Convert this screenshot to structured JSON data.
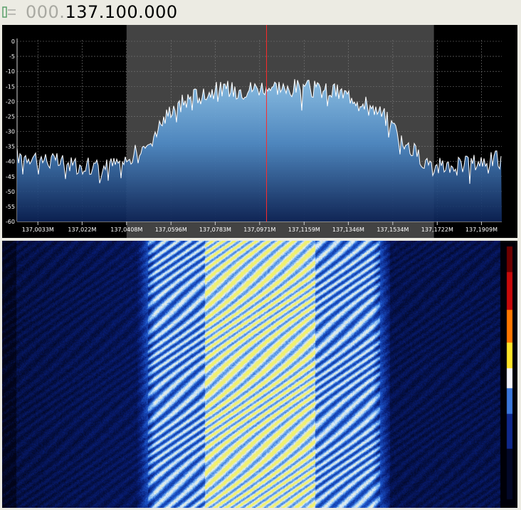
{
  "frequency": {
    "prefix": "000.",
    "value": "137.100.000"
  },
  "spectrum": {
    "y_ticks": [
      "0",
      "-5",
      "-10",
      "-15",
      "-20",
      "-25",
      "-30",
      "-35",
      "-40",
      "-45",
      "-50",
      "-55",
      "-60"
    ],
    "x_ticks": [
      "137,0033M",
      "137,022M",
      "137,0408M",
      "137,0596M",
      "137,0783M",
      "137,0971M",
      "137,1159M",
      "137,1346M",
      "137,1534M",
      "137,1722M",
      "137,1909M"
    ]
  },
  "chart_data": {
    "type": "area",
    "ylim": [
      -60,
      0
    ],
    "xlim": [
      136.9945,
      137.1995
    ],
    "center_frequency": 137.1,
    "passband": [
      137.0408,
      137.1708
    ],
    "x": [
      137.0,
      137.01,
      137.02,
      137.03,
      137.04,
      137.05,
      137.06,
      137.07,
      137.08,
      137.09,
      137.1,
      137.11,
      137.12,
      137.13,
      137.14,
      137.15,
      137.16,
      137.17,
      137.18,
      137.19,
      137.198
    ],
    "y": [
      -38,
      -40,
      -41,
      -42,
      -40,
      -34,
      -22,
      -18,
      -16,
      -16,
      -15,
      -15,
      -16,
      -17,
      -19,
      -25,
      -35,
      -42,
      -41,
      -40,
      -39
    ]
  },
  "colors": {
    "trace": "#ffffff",
    "center_line": "#ff2a2a",
    "fill_top": "#8fc6ee",
    "fill_bottom": "#0f2a5c",
    "passband": "#5a5a5a"
  },
  "icons": {
    "frequency": "tuning-icon"
  }
}
